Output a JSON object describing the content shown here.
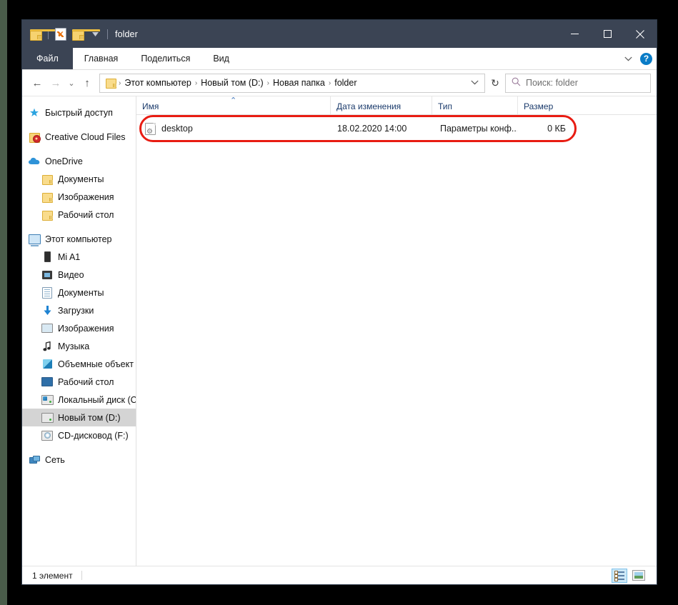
{
  "window": {
    "title": "folder",
    "quick_access": [
      {
        "name": "folder-icon",
        "label": "folder"
      },
      {
        "name": "properties-icon",
        "label": "Свойства"
      },
      {
        "name": "new-folder-icon",
        "label": "Создать папку"
      },
      {
        "name": "customize-qat-caret",
        "label": "Настроить панель быстрого доступа"
      }
    ],
    "controls": {
      "minimize": "─",
      "maximize": "□",
      "close": "✕"
    }
  },
  "ribbon": {
    "tabs": [
      {
        "label": "Файл",
        "active": true
      },
      {
        "label": "Главная",
        "active": false
      },
      {
        "label": "Поделиться",
        "active": false
      },
      {
        "label": "Вид",
        "active": false
      }
    ],
    "expand_caret": "⌄",
    "help_label": "?"
  },
  "address": {
    "back": "←",
    "forward": "→",
    "recent": "⌄",
    "up": "↑",
    "breadcrumbs": [
      "Этот компьютер",
      "Новый том (D:)",
      "Новая папка",
      "folder"
    ],
    "separator": "›",
    "dropdown_caret": "⌄",
    "refresh": "↻"
  },
  "search": {
    "placeholder": "Поиск: folder",
    "icon": "⌕"
  },
  "sidebar": {
    "items": [
      {
        "label": "Быстрый доступ",
        "icon": "star-icon",
        "indent": 0,
        "selected": false
      },
      {
        "label": "Creative Cloud Files",
        "icon": "creative-cloud-icon",
        "indent": 0,
        "selected": false
      },
      {
        "label": "OneDrive",
        "icon": "cloud-icon",
        "indent": 0,
        "selected": false
      },
      {
        "label": "Документы",
        "icon": "folder-icon",
        "indent": 1,
        "selected": false
      },
      {
        "label": "Изображения",
        "icon": "folder-icon",
        "indent": 1,
        "selected": false
      },
      {
        "label": "Рабочий стол",
        "icon": "folder-icon",
        "indent": 1,
        "selected": false
      },
      {
        "label": "Этот компьютер",
        "icon": "computer-icon",
        "indent": 0,
        "selected": false
      },
      {
        "label": "Mi A1",
        "icon": "phone-icon",
        "indent": 1,
        "selected": false
      },
      {
        "label": "Видео",
        "icon": "video-icon",
        "indent": 1,
        "selected": false
      },
      {
        "label": "Документы",
        "icon": "documents-icon",
        "indent": 1,
        "selected": false
      },
      {
        "label": "Загрузки",
        "icon": "downloads-icon",
        "indent": 1,
        "selected": false
      },
      {
        "label": "Изображения",
        "icon": "pictures-icon",
        "indent": 1,
        "selected": false
      },
      {
        "label": "Музыка",
        "icon": "music-icon",
        "indent": 1,
        "selected": false
      },
      {
        "label": "Объемные объект",
        "icon": "3d-objects-icon",
        "indent": 1,
        "selected": false
      },
      {
        "label": "Рабочий стол",
        "icon": "desktop-icon",
        "indent": 1,
        "selected": false
      },
      {
        "label": "Локальный диск (C",
        "icon": "local-disk-icon",
        "indent": 1,
        "selected": false
      },
      {
        "label": "Новый том (D:)",
        "icon": "drive-icon",
        "indent": 1,
        "selected": true
      },
      {
        "label": "CD-дисковод (F:)",
        "icon": "cd-drive-icon",
        "indent": 1,
        "selected": false
      },
      {
        "label": "Сеть",
        "icon": "network-icon",
        "indent": 0,
        "selected": false
      }
    ]
  },
  "filelist": {
    "columns": [
      "Имя",
      "Дата изменения",
      "Тип",
      "Размер"
    ],
    "sort_caret": "⌃",
    "rows": [
      {
        "name": "desktop",
        "date": "18.02.2020 14:00",
        "type": "Параметры конф...",
        "size": "0 КБ",
        "icon": "config-settings-icon"
      }
    ]
  },
  "status": {
    "item_count": "1 элемент"
  },
  "view_buttons": {
    "details": "Таблица",
    "large_icons": "Крупные значки"
  },
  "colors": {
    "titlebar": "#3b4454",
    "annotation": "#e81c12",
    "selection": "#d4d4d4",
    "column_header_text": "#1a3a6b"
  }
}
